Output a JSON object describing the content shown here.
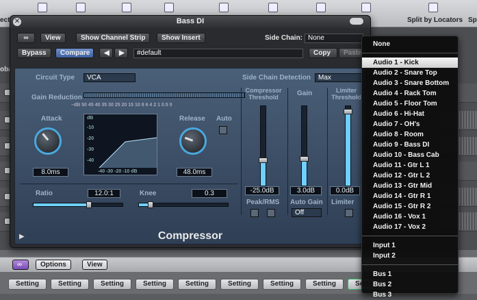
{
  "host": {
    "toolbar_left_label": "ecto",
    "split_locators": "Split by Locators",
    "split_partial": "Sp",
    "tracks_label_partial": "oba"
  },
  "plugin": {
    "title": "Bass DI",
    "view": "View",
    "show_channel_strip": "Show Channel Strip",
    "show_insert": "Show Insert",
    "side_chain_label": "Side Chain:",
    "side_chain_value": "None",
    "bypass": "Bypass",
    "compare": "Compare",
    "preset": "#default",
    "copy": "Copy",
    "paste": "Paste",
    "circuit_type_label": "Circuit Type",
    "circuit_type_value": "VCA",
    "sc_detection_label": "Side Chain Detection",
    "sc_detection_value": "Max",
    "gain_reduction": "Gain Reduction",
    "gr_scale": "–dB  50  45  40  35  30  25  20  15  10  8  6  4  2  1  0.5  0",
    "attack_label": "Attack",
    "attack_value": "8.0ms",
    "release_label": "Release",
    "release_value": "48.0ms",
    "auto_label": "Auto",
    "graph_db": "dB",
    "graph_y": [
      "-10",
      "-20",
      "-30",
      "-40"
    ],
    "graph_x": "-40 -30 -20 -10  dB",
    "ratio_label": "Ratio",
    "ratio_value": "12.0:1",
    "knee_label": "Knee",
    "knee_value": "0.3",
    "threshold_label": "Compressor Threshold",
    "threshold_value": "-25.0dB",
    "threshold_level": 0.32,
    "gain_label": "Gain",
    "gain_value": "3.0dB",
    "gain_level": 0.34,
    "limiter_label": "Limiter Threshold",
    "limiter_value": "0.0dB",
    "limiter_level": 0.93,
    "peak_rms": "Peak/RMS",
    "auto_gain": "Auto Gain",
    "auto_gain_value": "Off",
    "limiter": "Limiter",
    "footer": "Compressor",
    "ratio_level": 0.62,
    "knee_level": 0.13
  },
  "menu": {
    "items": [
      "None",
      "Audio 1 - Kick",
      "Audio 2 - Snare Top",
      "Audio 3 - Snare Bottom",
      "Audio 4 - Rack Tom",
      "Audio 5 - Floor Tom",
      "Audio 6 - Hi-Hat",
      "Audio 7 - OH's",
      "Audio 8 - Room",
      "Audio 9 - Bass DI",
      "Audio 10 - Bass Cab",
      "Audio 11 - Gtr L 1",
      "Audio 12 - Gtr L 2",
      "Audio 13 - Gtr Mid",
      "Audio 14 - Gtr R 1",
      "Audio 15 - Gtr R 2",
      "Audio 16 - Vox 1",
      "Audio 17 - Vox 2",
      "Input 1",
      "Input 2",
      "Bus 1",
      "Bus 2",
      "Bus 3"
    ],
    "highlighted": "Audio 1 - Kick"
  },
  "bottom": {
    "options": "Options",
    "view": "View",
    "setting": "Setting"
  }
}
